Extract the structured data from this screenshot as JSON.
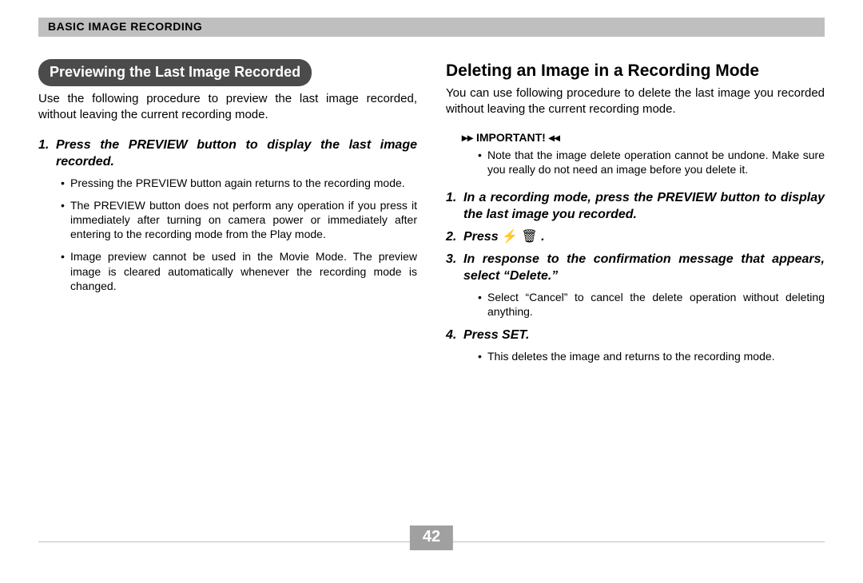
{
  "header": {
    "section": "BASIC IMAGE RECORDING"
  },
  "left": {
    "title": "Previewing the Last Image Recorded",
    "intro": "Use the following procedure to preview the last image recorded, without leaving the current recording mode.",
    "step1": {
      "num": "1.",
      "text": "Press the PREVIEW button to display the last image recorded."
    },
    "bullets": [
      "Pressing the PREVIEW button again returns to the recording mode.",
      "The PREVIEW button does not perform any operation if you press it immediately after turning on camera power or immediately after entering to the recording mode from the Play mode.",
      "Image preview cannot be used in the Movie Mode. The preview image is cleared automatically whenever the recording mode is changed."
    ]
  },
  "right": {
    "title": "Deleting an Image in a Recording Mode",
    "intro": "You can use following procedure to delete the last image you recorded without leaving the current recording mode.",
    "important_label": "IMPORTANT!",
    "important_note": "Note that the image delete operation cannot be undone. Make sure you really do not need an image before you delete it.",
    "step1": {
      "num": "1.",
      "text": "In a recording mode, press the PREVIEW button to display the last image you recorded."
    },
    "step2": {
      "num": "2.",
      "text": "Press ",
      "glyph1": "⚡",
      "glyph2": "🗑",
      "suffix": " ."
    },
    "step3": {
      "num": "3.",
      "text": "In response to the confirmation message that appears, select “Delete.”"
    },
    "step3_bullet": "Select “Cancel” to cancel the delete operation without deleting anything.",
    "step4": {
      "num": "4.",
      "text": "Press SET."
    },
    "step4_bullet": "This deletes the image and returns to the recording mode."
  },
  "page": "42"
}
